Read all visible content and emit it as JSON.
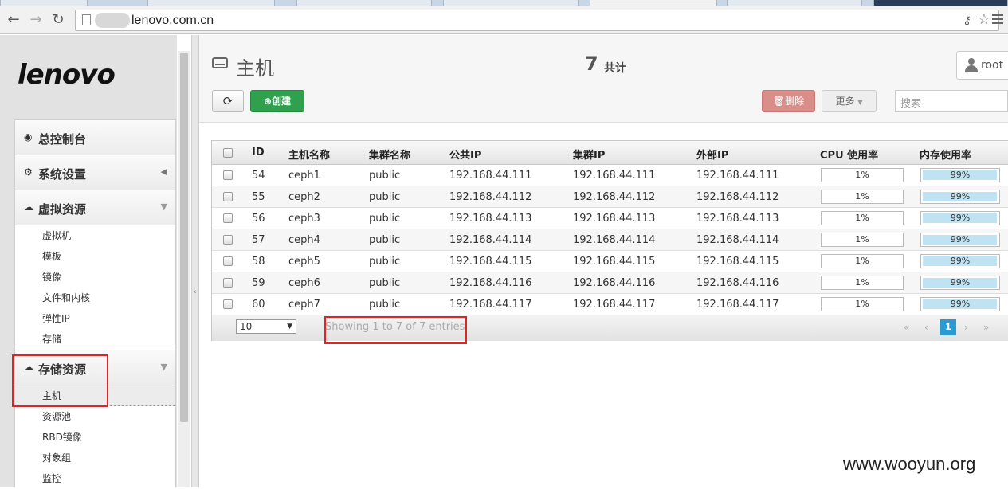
{
  "browser": {
    "url": "lenovo.com.cn"
  },
  "sidebar": {
    "logo": "lenovo",
    "sections": [
      {
        "label": "总控制台",
        "icon": "dashboard-icon",
        "items": []
      },
      {
        "label": "系统设置",
        "icon": "cogs-icon",
        "items": []
      },
      {
        "label": "虚拟资源",
        "icon": "cloud-icon",
        "items": [
          "虚拟机",
          "模板",
          "镜像",
          "文件和内核",
          "弹性IP",
          "存储"
        ]
      },
      {
        "label": "存储资源",
        "icon": "cloud-icon",
        "items": [
          "主机",
          "资源池",
          "RBD镜像",
          "对象组",
          "监控"
        ]
      }
    ]
  },
  "header": {
    "title": "主机",
    "count": "7",
    "count_label": "共计",
    "user": "root"
  },
  "toolbar": {
    "create_label": "创建",
    "delete_label": "删除",
    "more_label": "更多",
    "search_placeholder": "搜索"
  },
  "table": {
    "columns": [
      "ID",
      "主机名称",
      "集群名称",
      "公共IP",
      "集群IP",
      "外部IP",
      "CPU 使用率",
      "内存使用率"
    ],
    "rows": [
      {
        "id": "54",
        "host": "ceph1",
        "cluster": "public",
        "public_ip": "192.168.44.111",
        "cluster_ip": "192.168.44.111",
        "external_ip": "192.168.44.111",
        "cpu": "1%",
        "mem": "99%"
      },
      {
        "id": "55",
        "host": "ceph2",
        "cluster": "public",
        "public_ip": "192.168.44.112",
        "cluster_ip": "192.168.44.112",
        "external_ip": "192.168.44.112",
        "cpu": "1%",
        "mem": "99%"
      },
      {
        "id": "56",
        "host": "ceph3",
        "cluster": "public",
        "public_ip": "192.168.44.113",
        "cluster_ip": "192.168.44.113",
        "external_ip": "192.168.44.113",
        "cpu": "1%",
        "mem": "99%"
      },
      {
        "id": "57",
        "host": "ceph4",
        "cluster": "public",
        "public_ip": "192.168.44.114",
        "cluster_ip": "192.168.44.114",
        "external_ip": "192.168.44.114",
        "cpu": "1%",
        "mem": "99%"
      },
      {
        "id": "58",
        "host": "ceph5",
        "cluster": "public",
        "public_ip": "192.168.44.115",
        "cluster_ip": "192.168.44.115",
        "external_ip": "192.168.44.115",
        "cpu": "1%",
        "mem": "99%"
      },
      {
        "id": "59",
        "host": "ceph6",
        "cluster": "public",
        "public_ip": "192.168.44.116",
        "cluster_ip": "192.168.44.116",
        "external_ip": "192.168.44.116",
        "cpu": "1%",
        "mem": "99%"
      },
      {
        "id": "60",
        "host": "ceph7",
        "cluster": "public",
        "public_ip": "192.168.44.117",
        "cluster_ip": "192.168.44.117",
        "external_ip": "192.168.44.117",
        "cpu": "1%",
        "mem": "99%"
      }
    ],
    "page_length": "10",
    "info": "Showing 1 to 7 of 7 entries",
    "current_page": "1"
  },
  "colors": {
    "create": "#2fa04e",
    "delete": "#d98e8a",
    "mem_fill": "#bfe3f2",
    "page_active": "#2a9bd2",
    "highlight": "#e02424"
  },
  "watermark": "www.wooyun.org"
}
